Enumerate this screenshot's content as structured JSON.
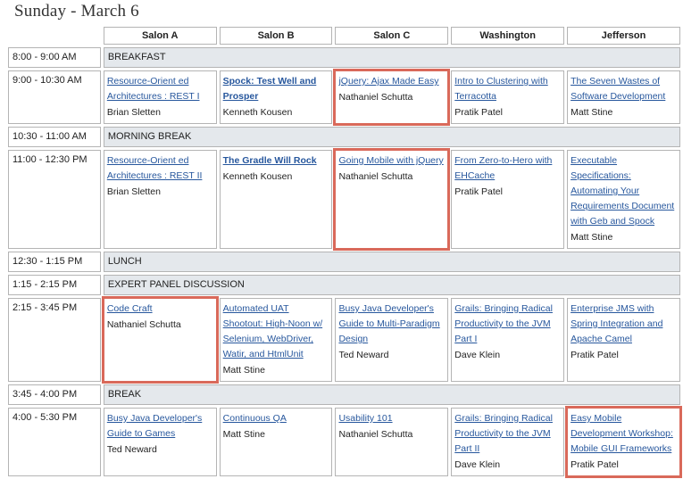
{
  "day_title": "Sunday - March 6",
  "rooms": [
    "Salon A",
    "Salon B",
    "Salon C",
    "Washington",
    "Jefferson"
  ],
  "rows": [
    {
      "time": "8:00 - 9:00 AM",
      "bar": "BREAKFAST"
    },
    {
      "time": "9:00 - 10:30 AM",
      "sessions": [
        {
          "title": "Resource-Orient ed Architectures : REST I",
          "speaker": "Brian Sletten"
        },
        {
          "title": "Spock: Test Well and Prosper",
          "speaker": "Kenneth Kousen",
          "bold": true
        },
        {
          "title": "jQuery: Ajax Made Easy",
          "speaker": "Nathaniel Schutta",
          "highlight": true
        },
        {
          "title": "Intro to Clustering with Terracotta",
          "speaker": "Pratik Patel"
        },
        {
          "title": "The Seven Wastes of Software Development",
          "speaker": "Matt Stine"
        }
      ]
    },
    {
      "time": "10:30 - 11:00 AM",
      "bar": "MORNING BREAK"
    },
    {
      "time": "11:00 - 12:30 PM",
      "sessions": [
        {
          "title": "Resource-Orient ed Architectures : REST II",
          "speaker": "Brian Sletten"
        },
        {
          "title": "The Gradle Will Rock",
          "speaker": "Kenneth Kousen",
          "bold": true
        },
        {
          "title": "Going Mobile with jQuery",
          "speaker": "Nathaniel Schutta",
          "highlight": true
        },
        {
          "title": "From Zero-to-Hero with EHCache",
          "speaker": "Pratik Patel"
        },
        {
          "title": "Executable Specifications: Automating Your Requirements Document with Geb and Spock",
          "speaker": "Matt Stine"
        }
      ]
    },
    {
      "time": "12:30 - 1:15 PM",
      "bar": "LUNCH"
    },
    {
      "time": "1:15 - 2:15 PM",
      "bar": "EXPERT PANEL DISCUSSION"
    },
    {
      "time": "2:15 - 3:45 PM",
      "sessions": [
        {
          "title": "Code Craft",
          "speaker": "Nathaniel Schutta",
          "highlight": true
        },
        {
          "title": "Automated UAT Shootout: High-Noon w/ Selenium, WebDriver, Watir, and HtmlUnit",
          "speaker": "Matt Stine"
        },
        {
          "title": "Busy Java Developer's Guide to Multi-Paradigm Design",
          "speaker": "Ted Neward"
        },
        {
          "title": "Grails: Bringing Radical Productivity to the JVM Part I",
          "speaker": "Dave Klein"
        },
        {
          "title": "Enterprise JMS with Spring Integration and Apache Camel",
          "speaker": "Pratik Patel"
        }
      ]
    },
    {
      "time": "3:45 - 4:00 PM",
      "bar": "BREAK"
    },
    {
      "time": "4:00 - 5:30 PM",
      "sessions": [
        {
          "title": "Busy Java Developer's Guide to Games",
          "speaker": "Ted Neward"
        },
        {
          "title": "Continuous QA",
          "speaker": "Matt Stine"
        },
        {
          "title": "Usability 101",
          "speaker": "Nathaniel Schutta"
        },
        {
          "title": "Grails: Bringing Radical Productivity to the JVM Part II",
          "speaker": "Dave Klein"
        },
        {
          "title": "Easy Mobile Development Workshop: Mobile GUI Frameworks",
          "speaker": "Pratik Patel",
          "highlight": true
        }
      ]
    }
  ],
  "colors": {
    "highlight": "#d9695a",
    "link": "#27579d",
    "bar": "#e4e8ec"
  }
}
